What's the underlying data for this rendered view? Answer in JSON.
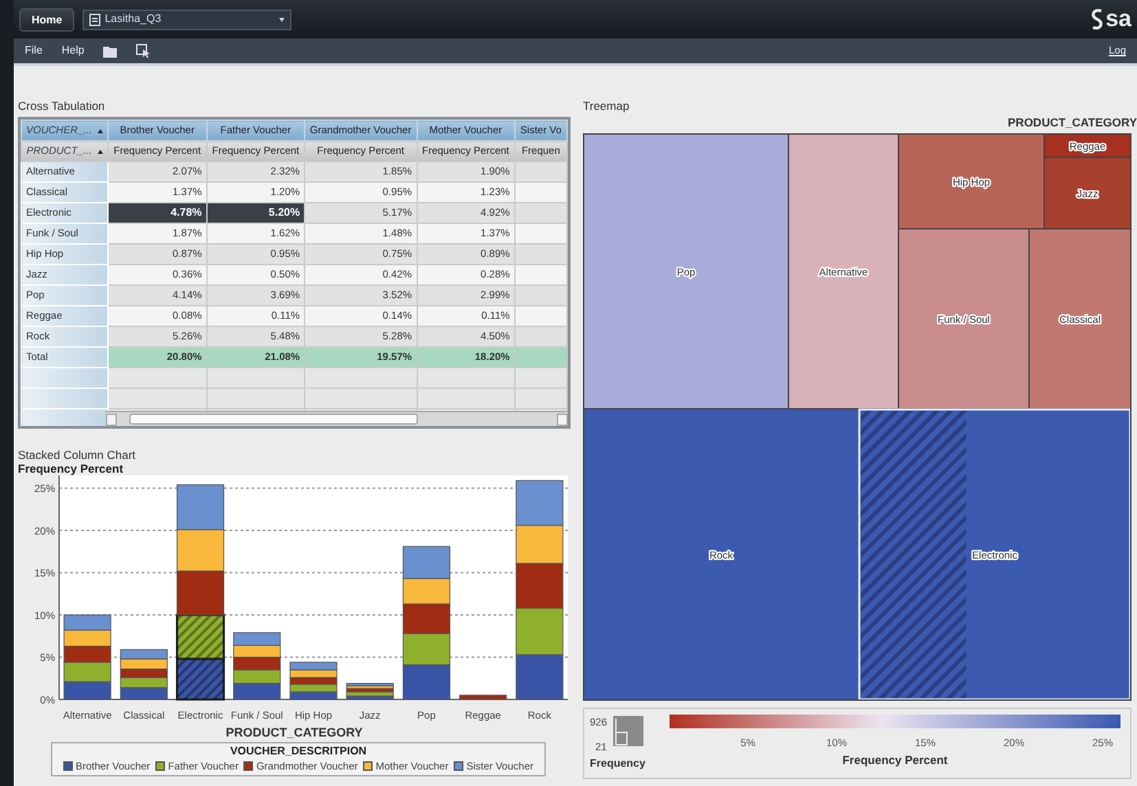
{
  "app_bar": {
    "home": "Home",
    "report": "Lasitha_Q3",
    "logo": "sa"
  },
  "menu": {
    "items": [
      "File",
      "Help"
    ],
    "logout": "Log"
  },
  "crosstab": {
    "title": "Cross Tabulation",
    "row_header": "VOUCHER_...",
    "row_subheader": "PRODUCT_...",
    "columns": [
      {
        "label": "Brother Voucher",
        "measure": "Frequency Percent"
      },
      {
        "label": "Father Voucher",
        "measure": "Frequency Percent"
      },
      {
        "label": "Grandmother Voucher",
        "measure": "Frequency Percent"
      },
      {
        "label": "Mother Voucher",
        "measure": "Frequency Percent"
      },
      {
        "label": "Sister Vo",
        "measure": "Frequen"
      }
    ],
    "rows": [
      {
        "label": "Alternative",
        "cells": [
          {
            "text": "2.07%",
            "selected": false
          },
          {
            "text": "2.32%",
            "selected": false
          },
          {
            "text": "1.85%",
            "selected": false
          },
          {
            "text": "1.90%",
            "selected": false
          }
        ]
      },
      {
        "label": "Classical",
        "cells": [
          {
            "text": "1.37%",
            "selected": false
          },
          {
            "text": "1.20%",
            "selected": false
          },
          {
            "text": "0.95%",
            "selected": false
          },
          {
            "text": "1.23%",
            "selected": false
          }
        ]
      },
      {
        "label": "Electronic",
        "cells": [
          {
            "text": "4.78%",
            "selected": true
          },
          {
            "text": "5.20%",
            "selected": true
          },
          {
            "text": "5.17%",
            "selected": false
          },
          {
            "text": "4.92%",
            "selected": false
          }
        ]
      },
      {
        "label": "Funk / Soul",
        "cells": [
          {
            "text": "1.87%",
            "selected": false
          },
          {
            "text": "1.62%",
            "selected": false
          },
          {
            "text": "1.48%",
            "selected": false
          },
          {
            "text": "1.37%",
            "selected": false
          }
        ]
      },
      {
        "label": "Hip Hop",
        "cells": [
          {
            "text": "0.87%",
            "selected": false
          },
          {
            "text": "0.95%",
            "selected": false
          },
          {
            "text": "0.75%",
            "selected": false
          },
          {
            "text": "0.89%",
            "selected": false
          }
        ]
      },
      {
        "label": "Jazz",
        "cells": [
          {
            "text": "0.36%",
            "selected": false
          },
          {
            "text": "0.50%",
            "selected": false
          },
          {
            "text": "0.42%",
            "selected": false
          },
          {
            "text": "0.28%",
            "selected": false
          }
        ]
      },
      {
        "label": "Pop",
        "cells": [
          {
            "text": "4.14%",
            "selected": false
          },
          {
            "text": "3.69%",
            "selected": false
          },
          {
            "text": "3.52%",
            "selected": false
          },
          {
            "text": "2.99%",
            "selected": false
          }
        ]
      },
      {
        "label": "Reggae",
        "cells": [
          {
            "text": "0.08%",
            "selected": false
          },
          {
            "text": "0.11%",
            "selected": false
          },
          {
            "text": "0.14%",
            "selected": false
          },
          {
            "text": "0.11%",
            "selected": false
          }
        ]
      },
      {
        "label": "Rock",
        "cells": [
          {
            "text": "5.26%",
            "selected": false
          },
          {
            "text": "5.48%",
            "selected": false
          },
          {
            "text": "5.28%",
            "selected": false
          },
          {
            "text": "4.50%",
            "selected": false
          }
        ]
      }
    ],
    "total": {
      "label": "Total",
      "cells": [
        "20.80%",
        "21.08%",
        "19.57%",
        "18.20%"
      ]
    }
  },
  "chart": {
    "title": "Stacked Column Chart",
    "legend_title": "VOUCHER_DESCRITPION",
    "chart_data": {
      "type": "bar",
      "xlabel": "PRODUCT_CATEGORY",
      "ylabel": "Frequency Percent",
      "stacked": true,
      "orientation": "vertical",
      "categories": [
        "Alternative",
        "Classical",
        "Electronic",
        "Funk / Soul",
        "Hip Hop",
        "Jazz",
        "Pop",
        "Reggae",
        "Rock"
      ],
      "series": [
        {
          "name": "Brother Voucher",
          "color": "#3a55a8",
          "values": [
            2.1,
            1.4,
            4.8,
            1.9,
            0.9,
            0.4,
            4.1,
            null,
            5.3
          ]
        },
        {
          "name": "Father Voucher",
          "color": "#8fb02c",
          "values": [
            2.3,
            1.2,
            5.2,
            1.6,
            0.9,
            0.5,
            3.7,
            null,
            5.5
          ]
        },
        {
          "name": "Grandmother Voucher",
          "color": "#a02c14",
          "values": [
            1.9,
            1.0,
            5.2,
            1.5,
            0.8,
            0.4,
            3.5,
            0.5,
            5.3
          ]
        },
        {
          "name": "Mother Voucher",
          "color": "#f8b83c",
          "values": [
            1.9,
            1.2,
            4.9,
            1.4,
            0.9,
            0.3,
            3.0,
            null,
            4.5
          ]
        },
        {
          "name": "Sister Voucher",
          "color": "#6a90d0",
          "values": [
            1.8,
            1.1,
            5.3,
            1.5,
            0.9,
            0.3,
            3.8,
            null,
            5.3
          ]
        }
      ],
      "ylim": [
        0,
        26.5
      ],
      "grid": true,
      "yticks": [
        {
          "value": 0,
          "label": "0%"
        },
        {
          "value": 5,
          "label": "5%"
        },
        {
          "value": 10,
          "label": "10%"
        },
        {
          "value": 15,
          "label": "15%"
        },
        {
          "value": 20,
          "label": "20%"
        },
        {
          "value": 25,
          "label": "25%"
        }
      ]
    }
  },
  "treemap": {
    "title": "Treemap",
    "level_label": "PRODUCT_CATEGORY",
    "tiles": [
      {
        "label": "Pop",
        "color": "#a8acd8",
        "selected": false
      },
      {
        "label": "Alternative",
        "color": "#d8b0b8",
        "selected": false
      },
      {
        "label": "Hip Hop",
        "color": "#b86458",
        "selected": false
      },
      {
        "label": "Reggae",
        "color": "#a83020",
        "selected": false
      },
      {
        "label": "Jazz",
        "color": "#a84030",
        "selected": false
      },
      {
        "label": "Funk / Soul",
        "color": "#c88c8c",
        "selected": false
      },
      {
        "label": "Classical",
        "color": "#c07870",
        "selected": false
      },
      {
        "label": "Rock",
        "color": "#3c5ab0",
        "selected": false
      },
      {
        "label": "Electronic",
        "color": "#3c5ab0",
        "selected": true
      }
    ],
    "legend": {
      "size_max": "926",
      "size_min": "21",
      "size_title": "Frequency",
      "ticks": [
        "5%",
        "10%",
        "15%",
        "20%",
        "25%"
      ],
      "color_title": "Frequency Percent"
    }
  }
}
